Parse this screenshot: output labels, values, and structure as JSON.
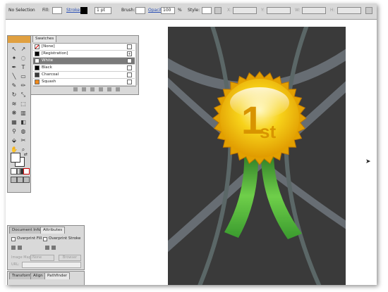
{
  "control_bar": {
    "selection_status": "No Selection",
    "fill_label": "Fill:",
    "stroke_label": "Stroke:",
    "stroke_weight": "1 pt",
    "brush_label": "Brush:",
    "opacity_label": "Opacity:",
    "opacity_value": "100",
    "opacity_unit": "%",
    "style_label": "Style:",
    "x_label": "X:",
    "y_label": "Y:",
    "w_label": "W:",
    "h_label": "H:"
  },
  "swatches_panel": {
    "tab_label": "Swatches",
    "items": [
      {
        "label": "[None]",
        "color": "#ffffff",
        "type": "none"
      },
      {
        "label": "[Registration]",
        "color": "#000000",
        "type": "registration"
      },
      {
        "label": "White",
        "color": "#ffffff",
        "type": "process",
        "selected": true
      },
      {
        "label": "Black",
        "color": "#000000",
        "type": "process"
      },
      {
        "label": "Charcoal",
        "color": "#3a3a3a",
        "type": "process"
      },
      {
        "label": "Squash",
        "color": "#f08a1c",
        "type": "process"
      }
    ]
  },
  "attributes_panel": {
    "tabs": [
      "Document Info",
      "Attributes"
    ],
    "overprint_fill": "Overprint Fill",
    "overprint_stroke": "Overprint Stroke",
    "image_map_label": "Image Map:",
    "image_map_value": "None",
    "browser_button": "Browser",
    "url_label": "URL:"
  },
  "bottom_panel": {
    "tabs": [
      "Transform",
      "Align",
      "Pathfinder"
    ]
  },
  "artwork": {
    "badge_text_number": "1",
    "badge_text_suffix": "st",
    "background_color": "#3a3a3a",
    "badge_color": "#f2c200",
    "ribbon_color": "#4aa83a"
  }
}
